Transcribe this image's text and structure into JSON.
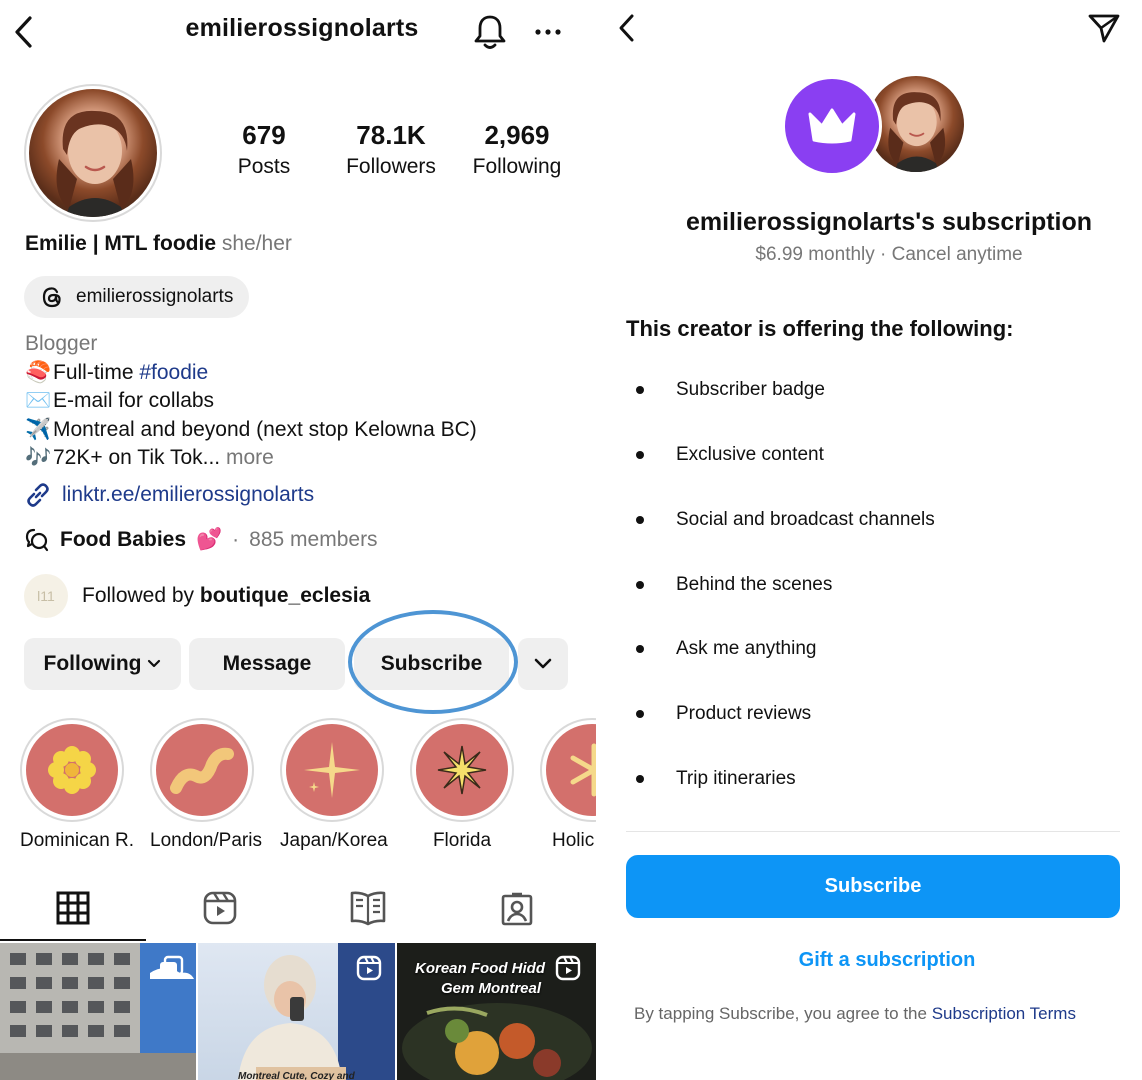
{
  "profile": {
    "username": "emilierossignolarts",
    "stats": [
      {
        "value": "679",
        "label": "Posts"
      },
      {
        "value": "78.1K",
        "label": "Followers"
      },
      {
        "value": "2,969",
        "label": "Following"
      }
    ],
    "name": "Emilie | MTL foodie",
    "pronouns": "she/her",
    "threads_handle": "emilierossignolarts",
    "category": "Blogger",
    "bio_lines": [
      {
        "emoji": "🍣",
        "text": "Full-time ",
        "hashtag": "#foodie"
      },
      {
        "emoji": "✉️",
        "text": "E-mail for collabs"
      },
      {
        "emoji": "✈️",
        "text": "Montreal and beyond (next stop Kelowna BC)"
      },
      {
        "emoji": "🎶",
        "text": "72K+ on Tik Tok...",
        "more": "more"
      }
    ],
    "link": "linktr.ee/emilierossignolarts",
    "channel": {
      "name": "Food Babies",
      "emoji": "💕",
      "members": "885 members"
    },
    "followed_by_prefix": "Followed by",
    "followed_by_user": "boutique_eclesia",
    "mini_avatar_text": "l11",
    "buttons": {
      "following": "Following",
      "message": "Message",
      "subscribe": "Subscribe"
    },
    "highlights": [
      "Dominican R.",
      "London/Paris",
      "Japan/Korea",
      "Florida",
      "Holic"
    ],
    "grid_overlay_text": [
      "Korean Food Hidd",
      "Gem Montreal"
    ],
    "grid_caption_fragment": "Montreal Cute, Cozy and"
  },
  "subscription": {
    "title": "emilierossignolarts's subscription",
    "price": "$6.99 monthly · Cancel anytime",
    "offer_heading": "This creator is offering the following:",
    "offers": [
      "Subscriber badge",
      "Exclusive content",
      "Social and broadcast channels",
      "Behind the scenes",
      "Ask me anything",
      "Product reviews",
      "Trip itineraries"
    ],
    "subscribe_button": "Subscribe",
    "gift_link": "Gift a subscription",
    "terms_prefix": "By tapping Subscribe, you agree to the",
    "terms_link": "Subscription Terms"
  },
  "colors": {
    "primary_blue": "#0d95f6",
    "link_blue": "#1e3a8a",
    "crown_purple": "#8a3ff2",
    "highlight_coral": "#d3706c",
    "annotation_circle": "#4e95d4"
  }
}
